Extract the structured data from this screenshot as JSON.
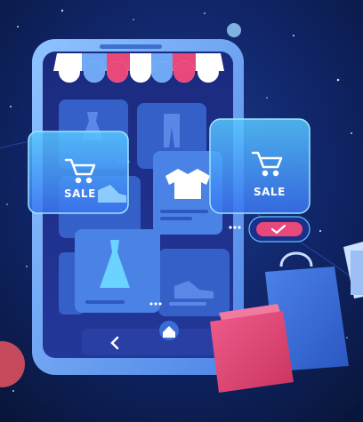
{
  "illustration": {
    "sale_badge_left": {
      "label": "SALE",
      "icon": "shopping-cart-icon"
    },
    "sale_badge_right": {
      "label": "SALE",
      "icon": "shopping-cart-icon"
    },
    "phone": {
      "nav": {
        "back_icon": "chevron-left-icon",
        "home_icon": "home-icon"
      },
      "products": [
        "dress-icon",
        "pants-icon",
        "dress-icon",
        "tshirt-icon",
        "sneaker-icon",
        "dress-icon",
        "sneaker-icon"
      ]
    },
    "confirm_button_icon": "checkmark-icon",
    "bags": [
      "shopping-bag-blue",
      "shopping-bag-pink",
      "shopping-bag-white"
    ],
    "colors": {
      "background": "#0b1a44",
      "phone_body": "#6ba6f0",
      "screen": "#1c2f8a",
      "card": "#3e6fd6",
      "accent_pink": "#e8497a",
      "glow": "#59c7ff"
    }
  }
}
